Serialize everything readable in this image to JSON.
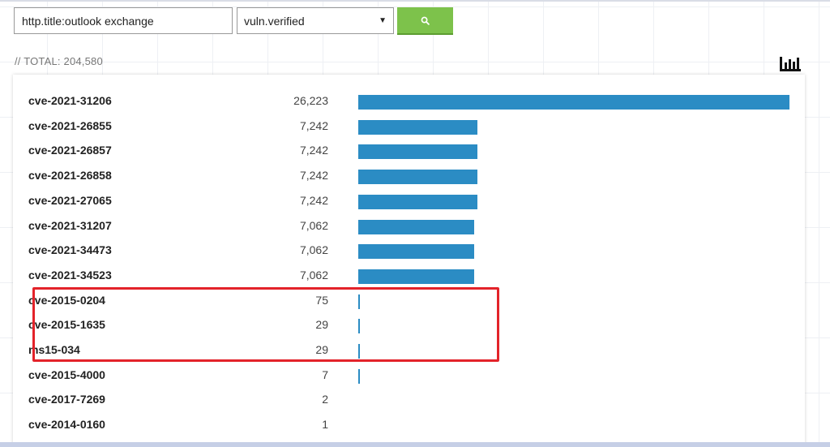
{
  "search": {
    "query": "http.title:outlook exchange",
    "facet_selected": "vuln.verified"
  },
  "summary": {
    "total_label": "// TOTAL: 204,580"
  },
  "colors": {
    "accent": "#7dc24b",
    "bar": "#2b8cc4",
    "highlight": "#e3232a"
  },
  "icons": {
    "search_button": "search-icon",
    "chart_toggle": "bar-chart-icon"
  },
  "facets": [
    {
      "name": "cve-2021-31206",
      "count": "26,223",
      "value": 26223
    },
    {
      "name": "cve-2021-26855",
      "count": "7,242",
      "value": 7242
    },
    {
      "name": "cve-2021-26857",
      "count": "7,242",
      "value": 7242
    },
    {
      "name": "cve-2021-26858",
      "count": "7,242",
      "value": 7242
    },
    {
      "name": "cve-2021-27065",
      "count": "7,242",
      "value": 7242
    },
    {
      "name": "cve-2021-31207",
      "count": "7,062",
      "value": 7062
    },
    {
      "name": "cve-2021-34473",
      "count": "7,062",
      "value": 7062
    },
    {
      "name": "cve-2021-34523",
      "count": "7,062",
      "value": 7062
    },
    {
      "name": "cve-2015-0204",
      "count": "75",
      "value": 75
    },
    {
      "name": "cve-2015-1635",
      "count": "29",
      "value": 29
    },
    {
      "name": "ms15-034",
      "count": "29",
      "value": 29
    },
    {
      "name": "cve-2015-4000",
      "count": "7",
      "value": 7
    },
    {
      "name": "cve-2017-7269",
      "count": "2",
      "value": 2
    },
    {
      "name": "cve-2014-0160",
      "count": "1",
      "value": 1
    }
  ],
  "highlighted_facets": [
    "cve-2021-31207",
    "cve-2021-34473",
    "cve-2021-34523"
  ]
}
